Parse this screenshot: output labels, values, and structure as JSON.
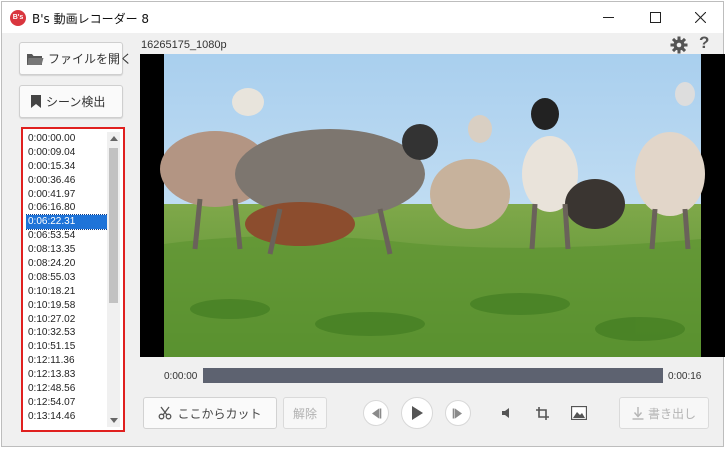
{
  "app": {
    "icon_text": "B's",
    "title": "B's 動画レコーダー 8"
  },
  "left": {
    "open_file_label": "ファイルを開く",
    "scene_detect_label": "シーン検出"
  },
  "scenes": {
    "items": [
      "0:00:00.00",
      "0:00:09.04",
      "0:00:15.34",
      "0:00:36.46",
      "0:00:41.97",
      "0:06:16.80",
      "0:06:22.31",
      "0:06:53.54",
      "0:08:13.35",
      "0:08:24.20",
      "0:08:55.03",
      "0:10:18.21",
      "0:10:19.58",
      "0:10:27.02",
      "0:10:32.53",
      "0:10:51.15",
      "0:12:11.36",
      "0:12:13.83",
      "0:12:48.56",
      "0:12:54.07",
      "0:13:14.46"
    ],
    "selected_index": 6
  },
  "player": {
    "file_name": "16265175_1080p",
    "help_label": "?",
    "time_start": "0:00:00",
    "time_end": "0:00:16"
  },
  "controls": {
    "cut_label": "ここからカット",
    "release_label": "解除",
    "export_label": "書き出し"
  },
  "colors": {
    "highlight_border": "#e0201f",
    "selection": "#1e73d8",
    "seekbar": "#5d6270"
  }
}
